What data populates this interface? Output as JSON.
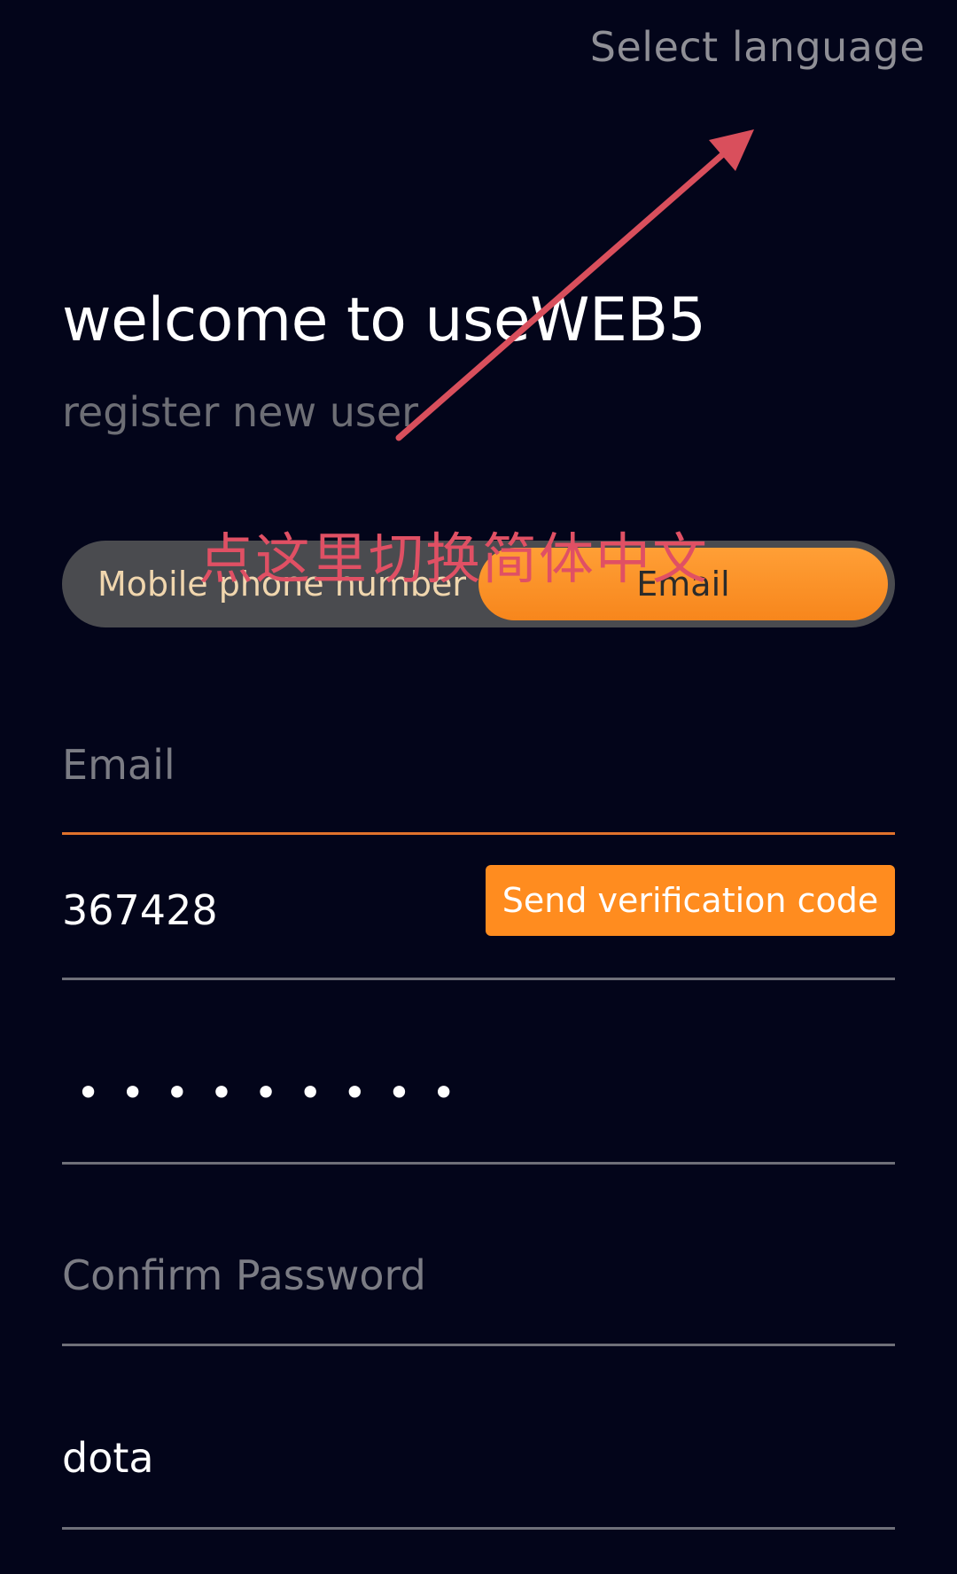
{
  "header": {
    "select_language": "Select language"
  },
  "welcome": {
    "title": "welcome to useWEB5",
    "subtitle": "register new user"
  },
  "annotation": {
    "text": "点这里切换简体中文"
  },
  "register_type_toggle": {
    "options": [
      "Mobile phone number",
      "Email"
    ],
    "selected": "Email"
  },
  "form": {
    "email": {
      "placeholder": "Email",
      "value": ""
    },
    "verification_code": {
      "value": "367428",
      "send_button_label": "Send verification code"
    },
    "password": {
      "masked_value": "•••••••••"
    },
    "confirm_password": {
      "placeholder": "Confirm Password",
      "value": ""
    },
    "invite_code": {
      "value": "dota"
    }
  },
  "colors": {
    "background": "#03051a",
    "accent": "#ff8c1f",
    "annotation": "#e05064"
  }
}
